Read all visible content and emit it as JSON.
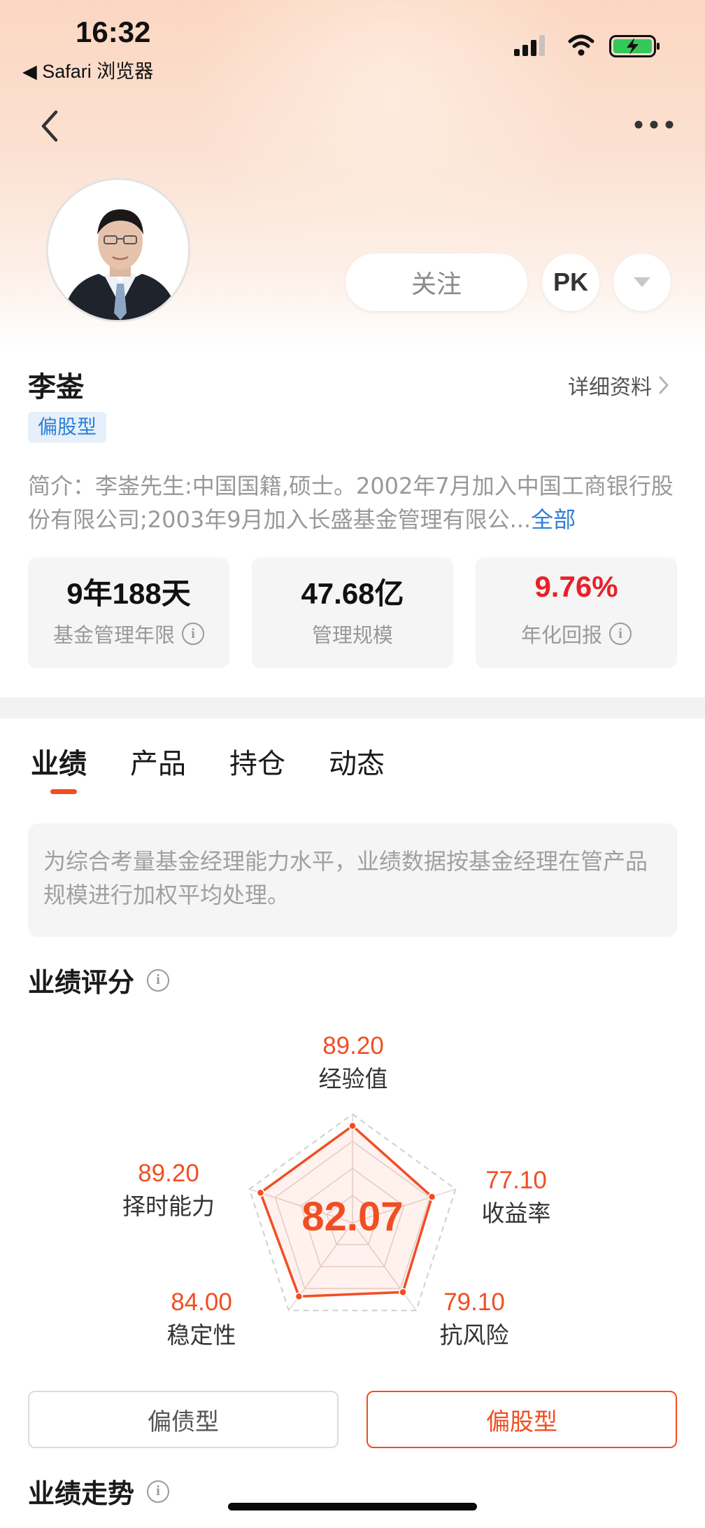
{
  "status_bar": {
    "time": "16:32",
    "back_app": "◀ Safari 浏览器",
    "battery_color": "#34c759"
  },
  "nav": {
    "back_icon": "chevron-left-icon",
    "more_icon": "more-horizontal-icon"
  },
  "profile": {
    "follow_label": "关注",
    "pk_label": "PK",
    "dropdown_icon": "triangle-down-icon",
    "name": "李崟",
    "detail_link": "详细资料",
    "type_tag": "偏股型",
    "intro_text": "简介：李崟先生:中国国籍,硕士。2002年7月加入中国工商银行股份有限公司;2003年9月加入长盛基金管理有限公...",
    "intro_more": "全部"
  },
  "stats": [
    {
      "value": "9年188天",
      "label": "基金管理年限",
      "has_info": true
    },
    {
      "value": "47.68亿",
      "label": "管理规模",
      "has_info": false
    },
    {
      "value": "9.76%",
      "label": "年化回报",
      "has_info": true,
      "color": "#e8202a"
    }
  ],
  "tabs": [
    {
      "label": "业绩",
      "active": true
    },
    {
      "label": "产品",
      "active": false
    },
    {
      "label": "持仓",
      "active": false
    },
    {
      "label": "动态",
      "active": false
    }
  ],
  "note": "为综合考量基金经理能力水平，业绩数据按基金经理在管产品规模进行加权平均处理。",
  "score_section": {
    "title": "业绩评分",
    "overall": "82.07",
    "dimensions": [
      {
        "label": "经验值",
        "value": "89.20",
        "score": 89.2
      },
      {
        "label": "收益率",
        "value": "77.10",
        "score": 77.1
      },
      {
        "label": "抗风险",
        "value": "79.10",
        "score": 79.1
      },
      {
        "label": "稳定性",
        "value": "84.00",
        "score": 84.0
      },
      {
        "label": "择时能力",
        "value": "89.20",
        "score": 89.2
      }
    ],
    "accent": "#f04e23"
  },
  "segments": [
    {
      "label": "偏债型",
      "active": false
    },
    {
      "label": "偏股型",
      "active": true
    }
  ],
  "trend_section": {
    "title": "业绩走势"
  }
}
